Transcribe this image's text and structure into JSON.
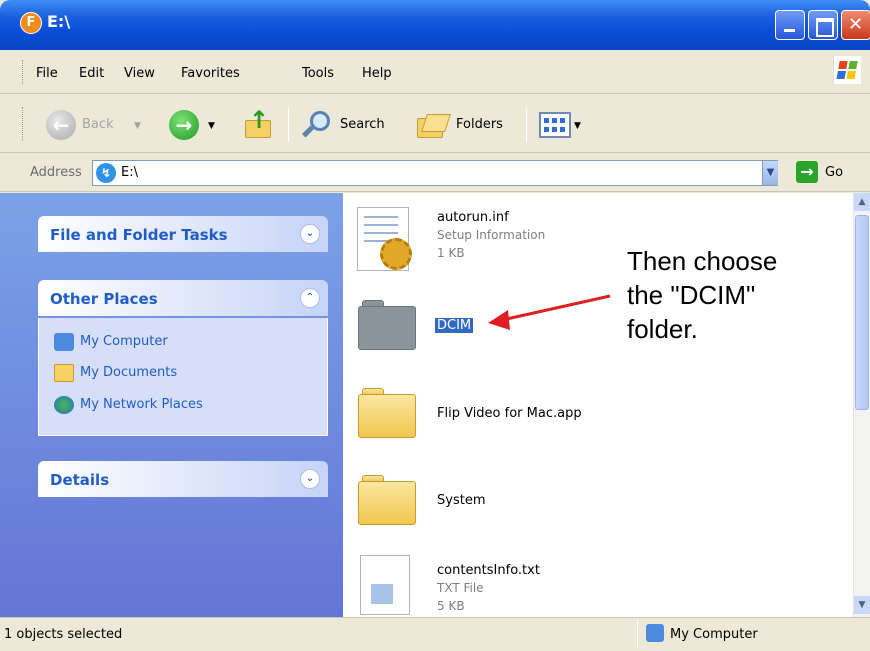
{
  "window": {
    "title": "E:\\",
    "title_icon": "F"
  },
  "menu": [
    "File",
    "Edit",
    "View",
    "Favorites",
    "Tools",
    "Help"
  ],
  "toolbar": {
    "back": "Back",
    "search": "Search",
    "folders": "Folders"
  },
  "address": {
    "label": "Address",
    "value": "E:\\",
    "go": "Go"
  },
  "left_pane": {
    "file_folder_tasks": "File and Folder Tasks",
    "other_places": "Other Places",
    "places": [
      "My Computer",
      "My Documents",
      "My Network Places"
    ],
    "details": "Details"
  },
  "files": [
    {
      "name": "autorun.inf",
      "type": "Setup Information",
      "size": "1 KB"
    },
    {
      "name": "DCIM"
    },
    {
      "name": "Flip Video for Mac.app"
    },
    {
      "name": "System"
    },
    {
      "name": "contentsInfo.txt",
      "type": "TXT File",
      "size": "5 KB"
    }
  ],
  "annotation": "Then choose\nthe \"DCIM\"\nfolder.",
  "status": {
    "left": "1 objects selected",
    "right": "My Computer"
  },
  "colors": {
    "title_bar": "#0a4fd8",
    "selection": "#316ac5",
    "task_pane": "#6375d6",
    "annotation_arrow": "#e02020"
  }
}
